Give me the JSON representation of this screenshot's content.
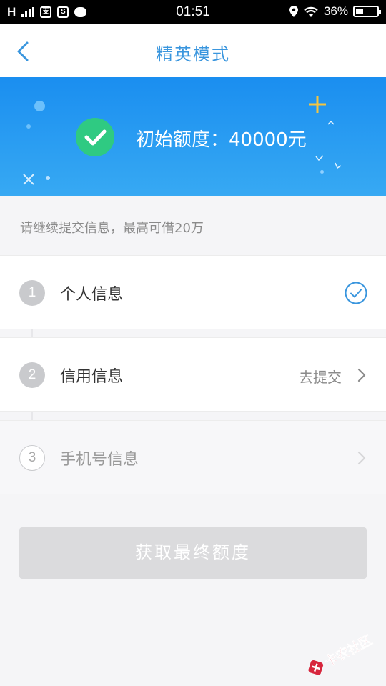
{
  "status_bar": {
    "network": "H",
    "time": "01:51",
    "battery": "36%"
  },
  "nav": {
    "title": "精英模式"
  },
  "banner": {
    "amount_text": "初始额度：40000元"
  },
  "hint": "请继续提交信息，最高可借20万",
  "steps": [
    {
      "number": "1",
      "label": "个人信息",
      "state": "done"
    },
    {
      "number": "2",
      "label": "信用信息",
      "action": "去提交",
      "state": "active"
    },
    {
      "number": "3",
      "label": "手机号信息",
      "state": "disabled"
    }
  ],
  "submit_label": "获取最终额度",
  "watermark": "卡农社区",
  "colors": {
    "accent": "#3a96de",
    "banner_top": "#1a8ef0",
    "banner_bottom": "#37a9f3",
    "success": "#2fca82",
    "watermark": "#d7263d"
  }
}
